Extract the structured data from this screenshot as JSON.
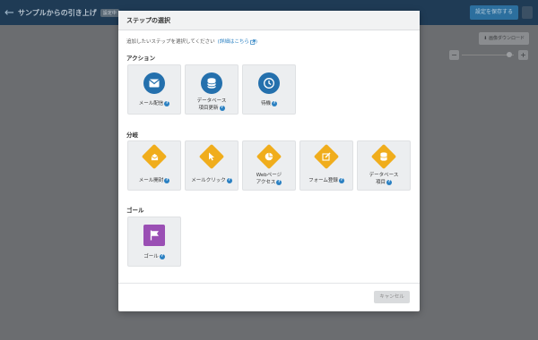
{
  "background": {
    "title": "サンプルからの引き上げ",
    "badge": "設定中",
    "save_label": "設定を保存する",
    "download_label": "画像ダウンロード",
    "zoom_minus": "−",
    "zoom_plus": "+"
  },
  "modal": {
    "title": "ステップの選択",
    "intro": "追加したいステップを選択してください",
    "intro_link": "(詳細はこちら",
    "sections": {
      "action": {
        "title": "アクション",
        "items": [
          {
            "label": "メール配信",
            "icon": "mail-icon"
          },
          {
            "label_line1": "データベース",
            "label_line2": "項目更新",
            "icon": "database-icon"
          },
          {
            "label": "待機",
            "icon": "clock-icon"
          }
        ]
      },
      "branch": {
        "title": "分岐",
        "items": [
          {
            "label": "メール開封",
            "icon": "mail-open-icon"
          },
          {
            "label": "メールクリック",
            "icon": "cursor-icon"
          },
          {
            "label_line1": "Webページ",
            "label_line2": "アクセス",
            "icon": "web-page-icon"
          },
          {
            "label": "フォーム登録",
            "icon": "form-edit-icon"
          },
          {
            "label_line1": "データベース",
            "label_line2": "項目",
            "icon": "database-icon"
          }
        ]
      },
      "goal": {
        "title": "ゴール",
        "items": [
          {
            "label": "ゴール",
            "icon": "flag-icon"
          }
        ]
      }
    },
    "help_mark": "?",
    "cancel_label": "キャンセル"
  },
  "colors": {
    "action_blue": "#2470ad",
    "branch_orange": "#f0ad1c",
    "goal_purple": "#9a4fb4",
    "link_blue": "#2a80c2"
  }
}
